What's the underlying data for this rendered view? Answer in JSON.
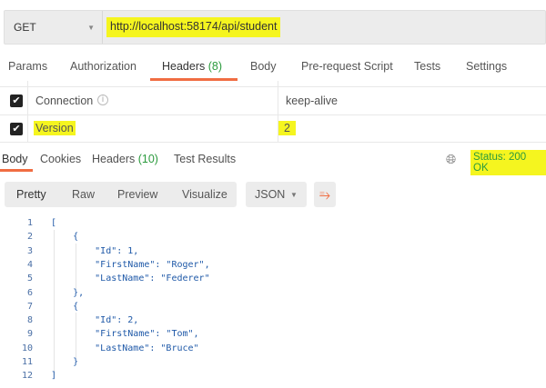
{
  "request": {
    "method": "GET",
    "url": "http://localhost:58174/api/student"
  },
  "request_tabs": [
    {
      "label": "Params"
    },
    {
      "label": "Authorization"
    },
    {
      "label": "Headers",
      "count": "(8)"
    },
    {
      "label": "Body"
    },
    {
      "label": "Pre-request Script"
    },
    {
      "label": "Tests"
    },
    {
      "label": "Settings"
    }
  ],
  "headers": [
    {
      "key": "Connection",
      "value": "keep-alive",
      "checked": true
    },
    {
      "key": "Version",
      "value": "2",
      "checked": true
    }
  ],
  "response_tabs": [
    {
      "label": "Body"
    },
    {
      "label": "Cookies"
    },
    {
      "label": "Headers",
      "count": "(10)"
    },
    {
      "label": "Test Results"
    }
  ],
  "status": {
    "label": "Status:",
    "value": "200 OK"
  },
  "view_modes": [
    "Pretty",
    "Raw",
    "Preview",
    "Visualize"
  ],
  "format": "JSON",
  "code_lines": [
    "[",
    "    {",
    "        \"Id\": 1,",
    "        \"FirstName\": \"Roger\",",
    "        \"LastName\": \"Federer\"",
    "    },",
    "    {",
    "        \"Id\": 2,",
    "        \"FirstName\": \"Tom\",",
    "        \"LastName\": \"Bruce\"",
    "    }",
    "]"
  ],
  "line_numbers": [
    "1",
    "2",
    "3",
    "4",
    "5",
    "6",
    "7",
    "8",
    "9",
    "10",
    "11",
    "12"
  ]
}
